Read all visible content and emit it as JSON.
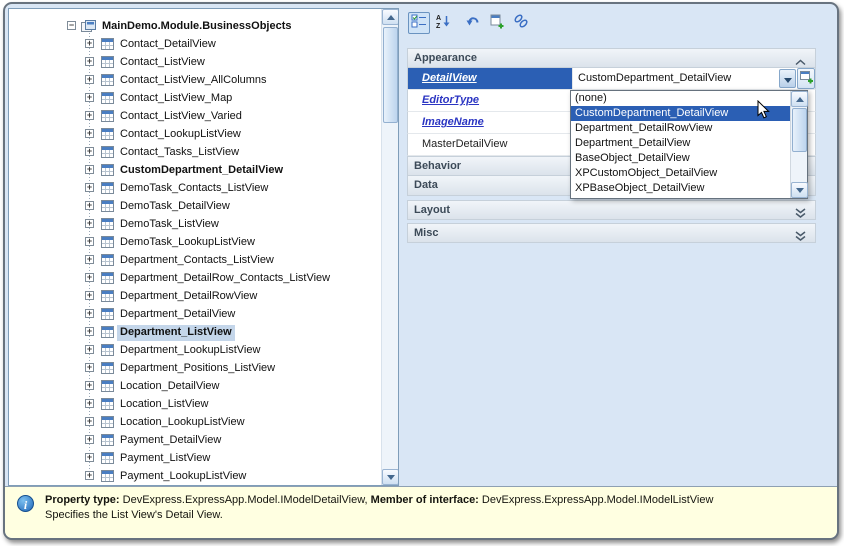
{
  "tree": {
    "root": "MainDemo.Module.BusinessObjects",
    "items": [
      {
        "label": "Contact_DetailView"
      },
      {
        "label": "Contact_ListView"
      },
      {
        "label": "Contact_ListView_AllColumns"
      },
      {
        "label": "Contact_ListView_Map"
      },
      {
        "label": "Contact_ListView_Varied"
      },
      {
        "label": "Contact_LookupListView"
      },
      {
        "label": "Contact_Tasks_ListView"
      },
      {
        "label": "CustomDepartment_DetailView",
        "bold": true
      },
      {
        "label": "DemoTask_Contacts_ListView"
      },
      {
        "label": "DemoTask_DetailView"
      },
      {
        "label": "DemoTask_ListView"
      },
      {
        "label": "DemoTask_LookupListView"
      },
      {
        "label": "Department_Contacts_ListView"
      },
      {
        "label": "Department_DetailRow_Contacts_ListView"
      },
      {
        "label": "Department_DetailRowView"
      },
      {
        "label": "Department_DetailView"
      },
      {
        "label": "Department_ListView",
        "bold": true,
        "selected": true
      },
      {
        "label": "Department_LookupListView"
      },
      {
        "label": "Department_Positions_ListView"
      },
      {
        "label": "Location_DetailView"
      },
      {
        "label": "Location_ListView"
      },
      {
        "label": "Location_LookupListView"
      },
      {
        "label": "Payment_DetailView"
      },
      {
        "label": "Payment_ListView"
      },
      {
        "label": "Payment_LookupListView"
      }
    ]
  },
  "toolbar": {
    "buttons": [
      "categorized-view",
      "sort-alphabetical",
      "undo",
      "add-node",
      "link"
    ]
  },
  "property_grid": {
    "categories": {
      "appearance": "Appearance",
      "behavior": "Behavior",
      "data": "Data",
      "layout": "Layout",
      "misc": "Misc"
    },
    "rows": [
      {
        "label": "DetailView",
        "value": "CustomDepartment_DetailView"
      },
      {
        "label": "EditorType",
        "value": ""
      },
      {
        "label": "ImageName",
        "value": ""
      },
      {
        "label": "MasterDetailView",
        "value": ""
      }
    ]
  },
  "dropdown": {
    "items": [
      {
        "label": "(none)"
      },
      {
        "label": "CustomDepartment_DetailView",
        "selected": true
      },
      {
        "label": "Department_DetailRowView"
      },
      {
        "label": "Department_DetailView"
      },
      {
        "label": "BaseObject_DetailView"
      },
      {
        "label": "XPCustomObject_DetailView"
      },
      {
        "label": "XPBaseObject_DetailView"
      }
    ]
  },
  "info_bar": {
    "label1": "Property type:",
    "value1": " DevExpress.ExpressApp.Model.IModelDetailView, ",
    "label2": "Member of interface:",
    "value2": " DevExpress.ExpressApp.Model.IModelListView",
    "line2": "Specifies the List View's Detail View."
  },
  "colors": {
    "selection": "#2b5fb4",
    "window_bg": "#d9e6f5",
    "tree_selection": "#c4d6ea",
    "info_bg": "#ffffe1"
  }
}
